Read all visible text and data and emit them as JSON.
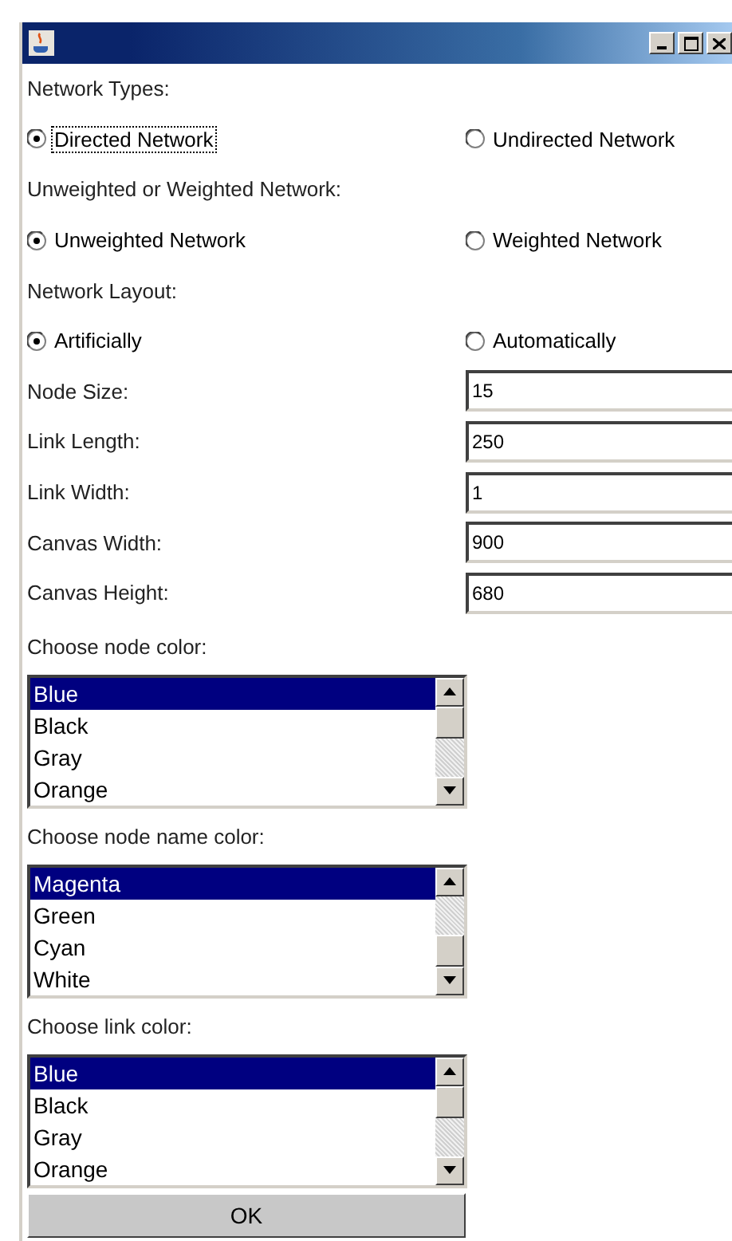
{
  "window": {
    "controls": [
      {
        "kind": "minimize"
      },
      {
        "kind": "maximize"
      },
      {
        "kind": "close"
      }
    ]
  },
  "sections": [
    {
      "kind": "radio",
      "label": "Network Types:",
      "options": [
        {
          "label": "Directed Network",
          "selected": true,
          "focused": true
        },
        {
          "label": "Undirected Network",
          "selected": false,
          "focused": false
        }
      ]
    },
    {
      "kind": "radio",
      "label": "Unweighted or Weighted Network:",
      "options": [
        {
          "label": "Unweighted Network",
          "selected": true,
          "focused": false
        },
        {
          "label": "Weighted Network",
          "selected": false,
          "focused": false
        }
      ]
    },
    {
      "kind": "radio",
      "label": "Network Layout:",
      "options": [
        {
          "label": "Artificially",
          "selected": true,
          "focused": false
        },
        {
          "label": "Automatically",
          "selected": false,
          "focused": false
        }
      ]
    }
  ],
  "fields": [
    {
      "label": "Node Size:",
      "value": "15"
    },
    {
      "label": "Link Length:",
      "value": "250"
    },
    {
      "label": "Link Width:",
      "value": "1"
    },
    {
      "label": "Canvas Width:",
      "value": "900"
    },
    {
      "label": "Canvas Height:",
      "value": "680"
    }
  ],
  "lists": [
    {
      "label": "Choose node color:",
      "items": [
        {
          "text": "Blue",
          "selected": true
        },
        {
          "text": "Black",
          "selected": false
        },
        {
          "text": "Gray",
          "selected": false
        },
        {
          "text": "Orange",
          "selected": false
        }
      ]
    },
    {
      "label": "Choose node name color:",
      "items": [
        {
          "text": "Magenta",
          "selected": true
        },
        {
          "text": "Green",
          "selected": false
        },
        {
          "text": "Cyan",
          "selected": false
        },
        {
          "text": "White",
          "selected": false
        }
      ]
    },
    {
      "label": "Choose link color:",
      "items": [
        {
          "text": "Blue",
          "selected": true
        },
        {
          "text": "Black",
          "selected": false
        },
        {
          "text": "Gray",
          "selected": false
        },
        {
          "text": "Orange",
          "selected": false
        }
      ]
    }
  ],
  "ok_button": "OK"
}
